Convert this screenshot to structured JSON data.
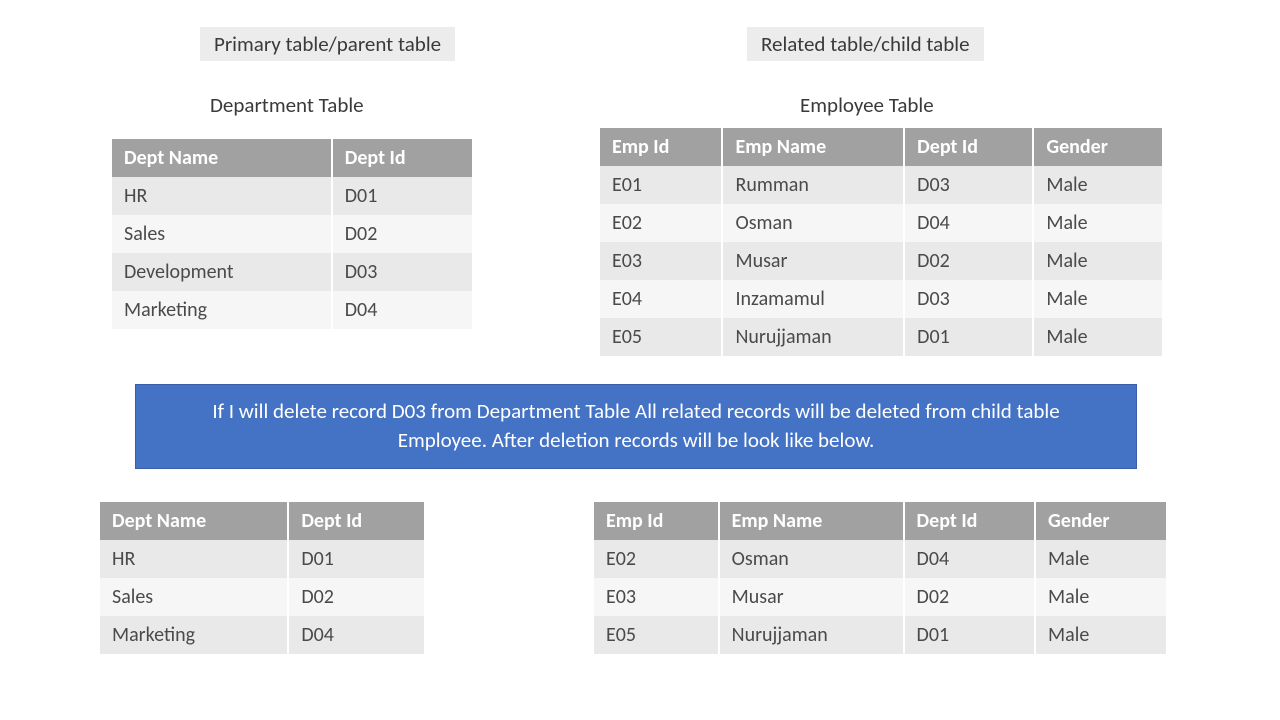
{
  "labels": {
    "primary": "Primary table/parent table",
    "related": "Related table/child table",
    "dept_title": "Department Table",
    "emp_title": "Employee Table"
  },
  "dept_headers": {
    "name": "Dept Name",
    "id": "Dept Id"
  },
  "emp_headers": {
    "id": "Emp Id",
    "name": "Emp Name",
    "dept": "Dept Id",
    "gender": "Gender"
  },
  "dept_before": [
    {
      "name": "HR",
      "id": "D01"
    },
    {
      "name": "Sales",
      "id": "D02"
    },
    {
      "name": "Development",
      "id": "D03"
    },
    {
      "name": "Marketing",
      "id": "D04"
    }
  ],
  "emp_before": [
    {
      "id": "E01",
      "name": "Rumman",
      "dept": "D03",
      "gender": "Male"
    },
    {
      "id": "E02",
      "name": "Osman",
      "dept": "D04",
      "gender": "Male"
    },
    {
      "id": "E03",
      "name": "Musar",
      "dept": "D02",
      "gender": "Male"
    },
    {
      "id": "E04",
      "name": "Inzamamul",
      "dept": "D03",
      "gender": "Male"
    },
    {
      "id": "E05",
      "name": "Nurujjaman",
      "dept": "D01",
      "gender": "Male"
    }
  ],
  "note": "If I will delete record D03 from Department Table All related records will be deleted from child table Employee. After deletion records will be look like below.",
  "dept_after": [
    {
      "name": "HR",
      "id": "D01"
    },
    {
      "name": "Sales",
      "id": "D02"
    },
    {
      "name": "Marketing",
      "id": "D04"
    }
  ],
  "emp_after": [
    {
      "id": "E02",
      "name": "Osman",
      "dept": "D04",
      "gender": "Male"
    },
    {
      "id": "E03",
      "name": "Musar",
      "dept": "D02",
      "gender": "Male"
    },
    {
      "id": "E05",
      "name": "Nurujjaman",
      "dept": "D01",
      "gender": "Male"
    }
  ]
}
